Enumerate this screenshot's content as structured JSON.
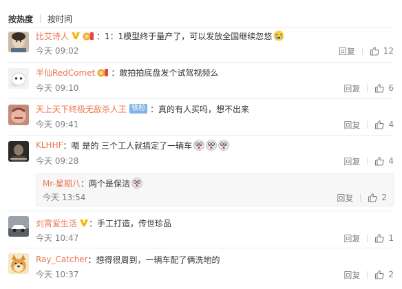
{
  "sort": {
    "hot": "按热度",
    "time": "按时间"
  },
  "comments": [
    {
      "name": "比艾诗人",
      "text": "1：1模型终于量产了，可以发放全国继续忽悠",
      "time": "今天 09:02",
      "reply": "回复",
      "likes": "12"
    },
    {
      "name": "半仙RedComet",
      "text": "敢拍拍底盘发个试驾视频么",
      "time": "今天 09:10",
      "reply": "回复",
      "likes": "6"
    },
    {
      "name": "天上天下终极无敌杀人王",
      "badge": "铁粉",
      "text": "真的有人买吗，想不出来",
      "time": "今天 09:41",
      "reply": "回复",
      "likes": "4"
    },
    {
      "name": "KLHHF",
      "text": "嗯 是的 三个工人就搞定了一辆车",
      "time": "今天 09:28",
      "reply": "回复",
      "likes": "4"
    },
    {
      "name": "Mr-星期八",
      "text": "两个是保洁",
      "time": "今天 13:54",
      "reply": "回复",
      "likes": "2"
    },
    {
      "name": "刘霄爱生活",
      "text": "手工打造，传世珍品",
      "time": "今天 10:47",
      "reply": "回复",
      "likes": "1"
    },
    {
      "name": "Ray_Catcher",
      "text": "想得很周到，一辆车配了俩洗地的",
      "time": "今天 10:37",
      "reply": "回复",
      "likes": "2"
    }
  ],
  "colors": {
    "name": "#eb7350",
    "meta": "#808080",
    "badge": "#7fb5e6",
    "vip": "#f7b500"
  },
  "icons": [
    "thumbs-up-icon",
    "vip-badge-icon",
    "medal-icon",
    "crying-emoji-icon",
    "doge-emoji-icon"
  ]
}
